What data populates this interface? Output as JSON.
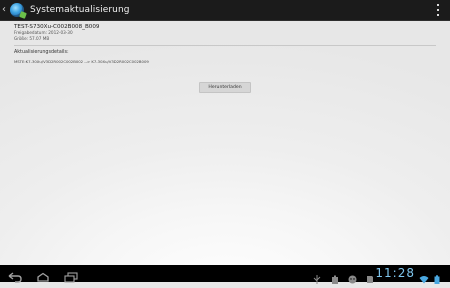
{
  "actionbar": {
    "title": "Systemaktualisierung",
    "icons": [
      "back-chevron-icon",
      "app-globe-icon",
      "overflow-menu-icon"
    ]
  },
  "update": {
    "package_name": "TEST-S730Xu-C002B008_B009",
    "release_date": "Freigabedatum: 2012-03-30",
    "size": "Größe: 57.07 MB",
    "details_label": "Aktualisierungsdetails:",
    "details_value": "MSTE:K7-30Xu/V3D2R002C002B002 --> K7-30Xu/V3D2R002C002B009"
  },
  "download_button": {
    "label": "Herunterladen"
  },
  "navbar": {
    "icons": [
      "back-icon",
      "home-icon",
      "recent-apps-icon"
    ],
    "status_icons": [
      "usb-icon",
      "battery-full-icon",
      "android-debug-icon",
      "sd-card-icon",
      "wifi-icon",
      "battery-icon"
    ],
    "clock": "11:28"
  },
  "colors": {
    "actionbar_bg": "#1b1b1b",
    "navbar_bg": "#000000",
    "clock": "#7fc6ee",
    "button_bg": "#d6d6d6"
  }
}
